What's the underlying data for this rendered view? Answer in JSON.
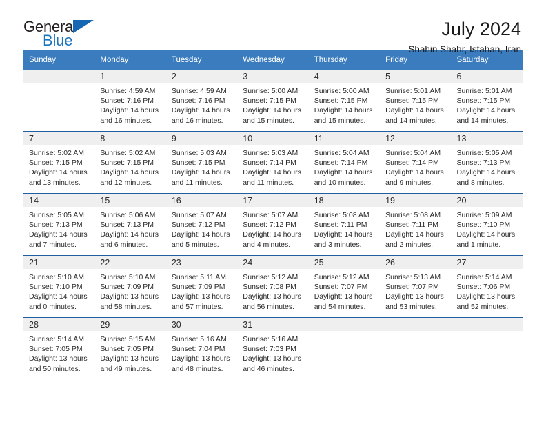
{
  "brand": {
    "name_top": "General",
    "name_bottom": "Blue",
    "triangle_color": "#1567b3",
    "blue_color": "#1b75bb"
  },
  "header": {
    "title": "July 2024",
    "subtitle": "Shahin Shahr, Isfahan, Iran"
  },
  "theme": {
    "header_bg": "#3a7cbe",
    "daynum_band_bg": "#efefef",
    "week_divider": "#1f5fa0",
    "text": "#2b2b2b"
  },
  "weekday_headers": [
    "Sunday",
    "Monday",
    "Tuesday",
    "Wednesday",
    "Thursday",
    "Friday",
    "Saturday"
  ],
  "weeks": [
    [
      {
        "day": "",
        "sunrise": "",
        "sunset": "",
        "daylight_line1": "",
        "daylight_line2": "",
        "empty": true
      },
      {
        "day": "1",
        "sunrise": "Sunrise: 4:59 AM",
        "sunset": "Sunset: 7:16 PM",
        "daylight_line1": "Daylight: 14 hours",
        "daylight_line2": "and 16 minutes."
      },
      {
        "day": "2",
        "sunrise": "Sunrise: 4:59 AM",
        "sunset": "Sunset: 7:16 PM",
        "daylight_line1": "Daylight: 14 hours",
        "daylight_line2": "and 16 minutes."
      },
      {
        "day": "3",
        "sunrise": "Sunrise: 5:00 AM",
        "sunset": "Sunset: 7:15 PM",
        "daylight_line1": "Daylight: 14 hours",
        "daylight_line2": "and 15 minutes."
      },
      {
        "day": "4",
        "sunrise": "Sunrise: 5:00 AM",
        "sunset": "Sunset: 7:15 PM",
        "daylight_line1": "Daylight: 14 hours",
        "daylight_line2": "and 15 minutes."
      },
      {
        "day": "5",
        "sunrise": "Sunrise: 5:01 AM",
        "sunset": "Sunset: 7:15 PM",
        "daylight_line1": "Daylight: 14 hours",
        "daylight_line2": "and 14 minutes."
      },
      {
        "day": "6",
        "sunrise": "Sunrise: 5:01 AM",
        "sunset": "Sunset: 7:15 PM",
        "daylight_line1": "Daylight: 14 hours",
        "daylight_line2": "and 14 minutes."
      }
    ],
    [
      {
        "day": "7",
        "sunrise": "Sunrise: 5:02 AM",
        "sunset": "Sunset: 7:15 PM",
        "daylight_line1": "Daylight: 14 hours",
        "daylight_line2": "and 13 minutes."
      },
      {
        "day": "8",
        "sunrise": "Sunrise: 5:02 AM",
        "sunset": "Sunset: 7:15 PM",
        "daylight_line1": "Daylight: 14 hours",
        "daylight_line2": "and 12 minutes."
      },
      {
        "day": "9",
        "sunrise": "Sunrise: 5:03 AM",
        "sunset": "Sunset: 7:15 PM",
        "daylight_line1": "Daylight: 14 hours",
        "daylight_line2": "and 11 minutes."
      },
      {
        "day": "10",
        "sunrise": "Sunrise: 5:03 AM",
        "sunset": "Sunset: 7:14 PM",
        "daylight_line1": "Daylight: 14 hours",
        "daylight_line2": "and 11 minutes."
      },
      {
        "day": "11",
        "sunrise": "Sunrise: 5:04 AM",
        "sunset": "Sunset: 7:14 PM",
        "daylight_line1": "Daylight: 14 hours",
        "daylight_line2": "and 10 minutes."
      },
      {
        "day": "12",
        "sunrise": "Sunrise: 5:04 AM",
        "sunset": "Sunset: 7:14 PM",
        "daylight_line1": "Daylight: 14 hours",
        "daylight_line2": "and 9 minutes."
      },
      {
        "day": "13",
        "sunrise": "Sunrise: 5:05 AM",
        "sunset": "Sunset: 7:13 PM",
        "daylight_line1": "Daylight: 14 hours",
        "daylight_line2": "and 8 minutes."
      }
    ],
    [
      {
        "day": "14",
        "sunrise": "Sunrise: 5:05 AM",
        "sunset": "Sunset: 7:13 PM",
        "daylight_line1": "Daylight: 14 hours",
        "daylight_line2": "and 7 minutes."
      },
      {
        "day": "15",
        "sunrise": "Sunrise: 5:06 AM",
        "sunset": "Sunset: 7:13 PM",
        "daylight_line1": "Daylight: 14 hours",
        "daylight_line2": "and 6 minutes."
      },
      {
        "day": "16",
        "sunrise": "Sunrise: 5:07 AM",
        "sunset": "Sunset: 7:12 PM",
        "daylight_line1": "Daylight: 14 hours",
        "daylight_line2": "and 5 minutes."
      },
      {
        "day": "17",
        "sunrise": "Sunrise: 5:07 AM",
        "sunset": "Sunset: 7:12 PM",
        "daylight_line1": "Daylight: 14 hours",
        "daylight_line2": "and 4 minutes."
      },
      {
        "day": "18",
        "sunrise": "Sunrise: 5:08 AM",
        "sunset": "Sunset: 7:11 PM",
        "daylight_line1": "Daylight: 14 hours",
        "daylight_line2": "and 3 minutes."
      },
      {
        "day": "19",
        "sunrise": "Sunrise: 5:08 AM",
        "sunset": "Sunset: 7:11 PM",
        "daylight_line1": "Daylight: 14 hours",
        "daylight_line2": "and 2 minutes."
      },
      {
        "day": "20",
        "sunrise": "Sunrise: 5:09 AM",
        "sunset": "Sunset: 7:10 PM",
        "daylight_line1": "Daylight: 14 hours",
        "daylight_line2": "and 1 minute."
      }
    ],
    [
      {
        "day": "21",
        "sunrise": "Sunrise: 5:10 AM",
        "sunset": "Sunset: 7:10 PM",
        "daylight_line1": "Daylight: 14 hours",
        "daylight_line2": "and 0 minutes."
      },
      {
        "day": "22",
        "sunrise": "Sunrise: 5:10 AM",
        "sunset": "Sunset: 7:09 PM",
        "daylight_line1": "Daylight: 13 hours",
        "daylight_line2": "and 58 minutes."
      },
      {
        "day": "23",
        "sunrise": "Sunrise: 5:11 AM",
        "sunset": "Sunset: 7:09 PM",
        "daylight_line1": "Daylight: 13 hours",
        "daylight_line2": "and 57 minutes."
      },
      {
        "day": "24",
        "sunrise": "Sunrise: 5:12 AM",
        "sunset": "Sunset: 7:08 PM",
        "daylight_line1": "Daylight: 13 hours",
        "daylight_line2": "and 56 minutes."
      },
      {
        "day": "25",
        "sunrise": "Sunrise: 5:12 AM",
        "sunset": "Sunset: 7:07 PM",
        "daylight_line1": "Daylight: 13 hours",
        "daylight_line2": "and 54 minutes."
      },
      {
        "day": "26",
        "sunrise": "Sunrise: 5:13 AM",
        "sunset": "Sunset: 7:07 PM",
        "daylight_line1": "Daylight: 13 hours",
        "daylight_line2": "and 53 minutes."
      },
      {
        "day": "27",
        "sunrise": "Sunrise: 5:14 AM",
        "sunset": "Sunset: 7:06 PM",
        "daylight_line1": "Daylight: 13 hours",
        "daylight_line2": "and 52 minutes."
      }
    ],
    [
      {
        "day": "28",
        "sunrise": "Sunrise: 5:14 AM",
        "sunset": "Sunset: 7:05 PM",
        "daylight_line1": "Daylight: 13 hours",
        "daylight_line2": "and 50 minutes."
      },
      {
        "day": "29",
        "sunrise": "Sunrise: 5:15 AM",
        "sunset": "Sunset: 7:05 PM",
        "daylight_line1": "Daylight: 13 hours",
        "daylight_line2": "and 49 minutes."
      },
      {
        "day": "30",
        "sunrise": "Sunrise: 5:16 AM",
        "sunset": "Sunset: 7:04 PM",
        "daylight_line1": "Daylight: 13 hours",
        "daylight_line2": "and 48 minutes."
      },
      {
        "day": "31",
        "sunrise": "Sunrise: 5:16 AM",
        "sunset": "Sunset: 7:03 PM",
        "daylight_line1": "Daylight: 13 hours",
        "daylight_line2": "and 46 minutes."
      },
      {
        "day": "",
        "sunrise": "",
        "sunset": "",
        "daylight_line1": "",
        "daylight_line2": "",
        "empty": true
      },
      {
        "day": "",
        "sunrise": "",
        "sunset": "",
        "daylight_line1": "",
        "daylight_line2": "",
        "empty": true
      },
      {
        "day": "",
        "sunrise": "",
        "sunset": "",
        "daylight_line1": "",
        "daylight_line2": "",
        "empty": true
      }
    ]
  ]
}
